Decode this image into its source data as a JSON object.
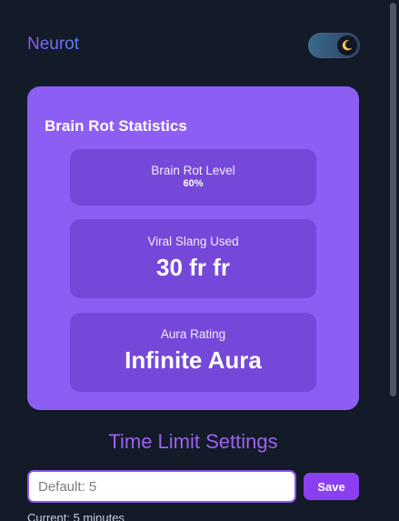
{
  "header": {
    "brand": "Neurot",
    "theme_toggle": {
      "state": "dark",
      "icon": "moon-icon"
    }
  },
  "stats_card": {
    "title": "Brain Rot Statistics",
    "stats": [
      {
        "label": "Brain Rot Level",
        "value": "60%"
      },
      {
        "label": "Viral Slang Used",
        "value": "30 fr fr"
      },
      {
        "label": "Aura Rating",
        "value": "Infinite Aura"
      }
    ]
  },
  "time_limit": {
    "title": "Time Limit Settings",
    "input_placeholder": "Default: 5",
    "input_value": "",
    "save_label": "Save",
    "current_text": "Current: 5 minutes"
  },
  "colors": {
    "background": "#131a28",
    "card": "#8c5ef4",
    "stat_box": "#7548d9",
    "accent": "#8b3ff0"
  }
}
